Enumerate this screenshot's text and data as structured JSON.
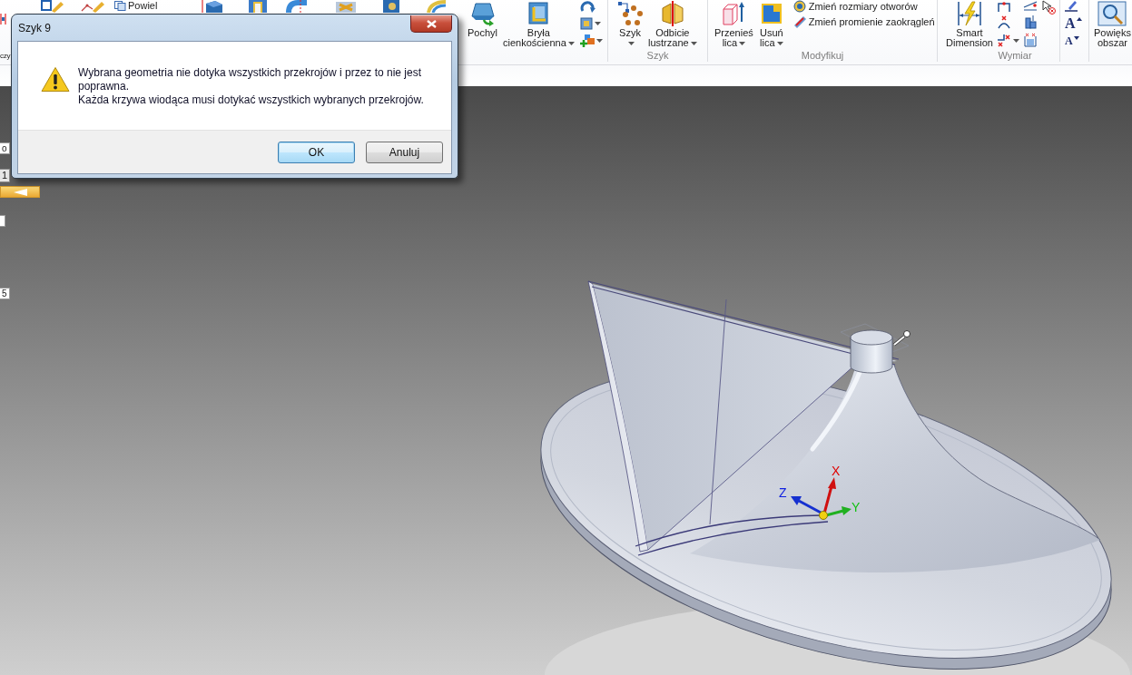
{
  "ribbon": {
    "edge_label": "czy",
    "duplicate_label": "Powiel",
    "groups": [
      {
        "items": [
          {
            "kind": "large",
            "lines": [
              "Pochyl"
            ],
            "dropdown": false
          },
          {
            "kind": "large",
            "lines": [
              "Bryła",
              "cienkościenna"
            ],
            "dropdown": true
          },
          {
            "kind": "stack",
            "tools": [
              {
                "dropdown": false
              },
              {
                "dropdown": true
              },
              {
                "dropdown": true
              }
            ]
          }
        ]
      },
      {
        "label": "Szyk",
        "items": [
          {
            "kind": "large",
            "lines": [
              "Szyk"
            ],
            "dropdown": true
          },
          {
            "kind": "large",
            "lines": [
              "Odbicie",
              "lustrzane"
            ],
            "dropdown": true
          }
        ]
      },
      {
        "label": "Modyfikuj",
        "items": [
          {
            "kind": "large",
            "lines": [
              "Przenieś",
              "lica"
            ],
            "dropdown": true
          },
          {
            "kind": "large",
            "lines": [
              "Usuń",
              "lica"
            ],
            "dropdown": true
          },
          {
            "kind": "list",
            "entries": [
              "Zmień rozmiary otworów",
              "Zmień promienie zaokrągleń"
            ]
          }
        ]
      },
      {
        "label": "Wymiar",
        "items": [
          {
            "kind": "large",
            "lines": [
              "Smart",
              "Dimension"
            ],
            "dropdown": false
          },
          {
            "kind": "stack",
            "tools": [
              {
                "dropdown": false
              },
              {
                "dropdown": false
              },
              {
                "dropdown": true
              }
            ]
          },
          {
            "kind": "stack",
            "tools": [
              {
                "dropdown": false
              },
              {
                "dropdown": false
              },
              {
                "dropdown": false
              }
            ]
          },
          {
            "kind": "stack",
            "tools": [
              {
                "dropdown": false
              }
            ]
          }
        ]
      },
      {
        "items": [
          {
            "kind": "text_tools",
            "tools": [
              {
                "kind": "icon"
              },
              {
                "kind": "glyph",
                "glyph": "A",
                "larger": true
              },
              {
                "kind": "glyph",
                "glyph": "A",
                "larger": false
              }
            ]
          }
        ]
      },
      {
        "items": [
          {
            "kind": "large",
            "lines": [
              "Powięks",
              "obszar"
            ],
            "dropdown": false
          }
        ]
      }
    ]
  },
  "left_panel": {
    "top_field": "o",
    "tab": "1",
    "bottom_field": "5"
  },
  "viewport": {
    "triad": {
      "x_label": "X",
      "y_label": "Y",
      "z_label": "Z"
    }
  },
  "dialog": {
    "title": "Szyk 9",
    "kind": "warning",
    "message": [
      "Wybrana geometria nie dotyka wszystkich przekrojów i przez to nie jest poprawna.",
      "Każda krzywa wiodąca musi dotykać wszystkich wybranych przekrojów."
    ],
    "buttons": [
      {
        "label": "OK",
        "default": true
      },
      {
        "label": "Anuluj",
        "default": false
      }
    ]
  }
}
